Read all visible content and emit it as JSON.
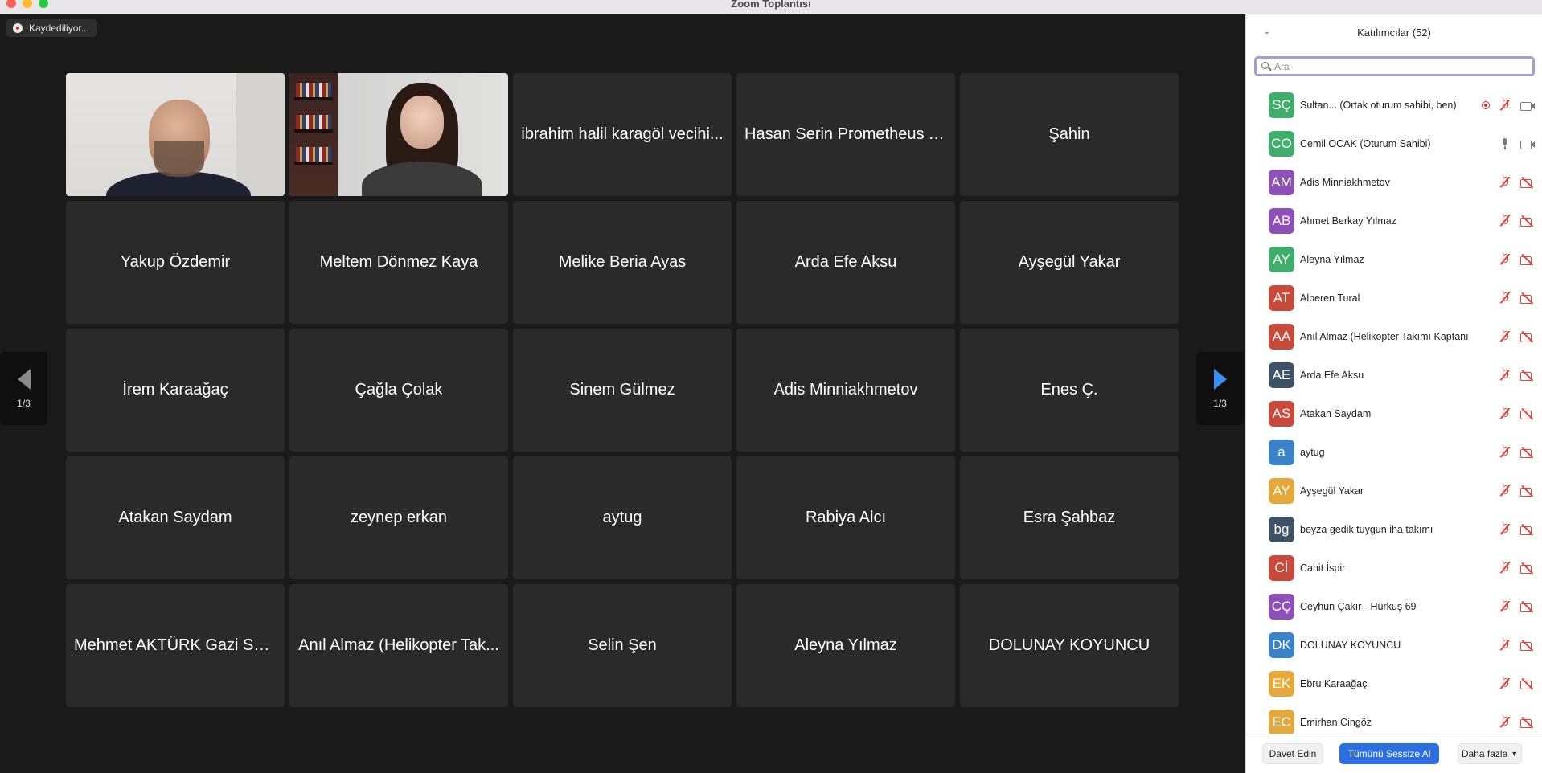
{
  "window": {
    "title": "Zoom Toplantısı"
  },
  "recording": {
    "label": "Kaydediliyor..."
  },
  "gallery": {
    "tiles": [
      "",
      "",
      "ibrahim halil karagöl vecihi...",
      "Hasan Serin Prometheus T...",
      "Şahin",
      "Yakup Özdemir",
      "Meltem Dönmez Kaya",
      "Melike Beria Ayas",
      "Arda Efe Aksu",
      "Ayşegül Yakar",
      "İrem Karaağaç",
      "Çağla Çolak",
      "Sinem Gülmez",
      "Adis Minniakhmetov",
      "Enes Ç.",
      "Atakan Saydam",
      "zeynep erkan",
      "aytug",
      "Rabiya Alcı",
      "Esra Şahbaz",
      "Mehmet AKTÜRK Gazi Sal...",
      "Anıl Almaz (Helikopter Tak...",
      "Selin Şen",
      "Aleyna Yılmaz",
      "DOLUNAY KOYUNCU"
    ],
    "page_left": "1/3",
    "page_right": "1/3"
  },
  "participants": {
    "title": "Katılımcılar (52)",
    "search_placeholder": "Ara",
    "list": [
      {
        "initials": "SÇ",
        "name": "Sultan... (Ortak oturum sahibi, ben)",
        "color": "#3fae6c",
        "mic": "off",
        "cam": "on",
        "rec": true
      },
      {
        "initials": "CO",
        "name": "Cemil OCAK (Oturum Sahibi)",
        "color": "#3fae6c",
        "mic": "on",
        "cam": "on",
        "rec": false
      },
      {
        "initials": "AM",
        "name": "Adis Minniakhmetov",
        "color": "#8e4fb9",
        "mic": "off",
        "cam": "off",
        "rec": false
      },
      {
        "initials": "AB",
        "name": "Ahmet Berkay Yılmaz",
        "color": "#8e4fb9",
        "mic": "off",
        "cam": "off",
        "rec": false
      },
      {
        "initials": "AY",
        "name": "Aleyna Yılmaz",
        "color": "#3fae6c",
        "mic": "off",
        "cam": "off",
        "rec": false
      },
      {
        "initials": "AT",
        "name": "Alperen Tural",
        "color": "#c94a3a",
        "mic": "off",
        "cam": "off",
        "rec": false
      },
      {
        "initials": "AA",
        "name": "Anıl Almaz (Helikopter Takımı Kaptanı",
        "color": "#c94a3a",
        "mic": "off",
        "cam": "off",
        "rec": false
      },
      {
        "initials": "AE",
        "name": "Arda Efe Aksu",
        "color": "#3e5266",
        "mic": "off",
        "cam": "off",
        "rec": false
      },
      {
        "initials": "AS",
        "name": "Atakan Saydam",
        "color": "#c94a3a",
        "mic": "off",
        "cam": "off",
        "rec": false
      },
      {
        "initials": "a",
        "name": "aytug",
        "color": "#3b82c9",
        "mic": "off",
        "cam": "off",
        "rec": false
      },
      {
        "initials": "AY",
        "name": "Ayşegül Yakar",
        "color": "#e5a83a",
        "mic": "off",
        "cam": "off",
        "rec": false
      },
      {
        "initials": "bg",
        "name": "beyza gedik tuygun iha takımı",
        "color": "#3e5266",
        "mic": "off",
        "cam": "off",
        "rec": false
      },
      {
        "initials": "Cİ",
        "name": "Cahit İspir",
        "color": "#c94a3a",
        "mic": "off",
        "cam": "off",
        "rec": false
      },
      {
        "initials": "CÇ",
        "name": "Ceyhun Çakır - Hürkuş 69",
        "color": "#8e4fb9",
        "mic": "off",
        "cam": "off",
        "rec": false
      },
      {
        "initials": "DK",
        "name": "DOLUNAY KOYUNCU",
        "color": "#3b82c9",
        "mic": "off",
        "cam": "off",
        "rec": false
      },
      {
        "initials": "EK",
        "name": "Ebru Karaağaç",
        "color": "#e5a83a",
        "mic": "off",
        "cam": "off",
        "rec": false
      },
      {
        "initials": "EC",
        "name": "Emirhan Cingöz",
        "color": "#e5a83a",
        "mic": "off",
        "cam": "off",
        "rec": false
      }
    ]
  },
  "footer": {
    "invite": "Davet Edin",
    "mute_all": "Tümünü Sessize Al",
    "more": "Daha fazla"
  }
}
